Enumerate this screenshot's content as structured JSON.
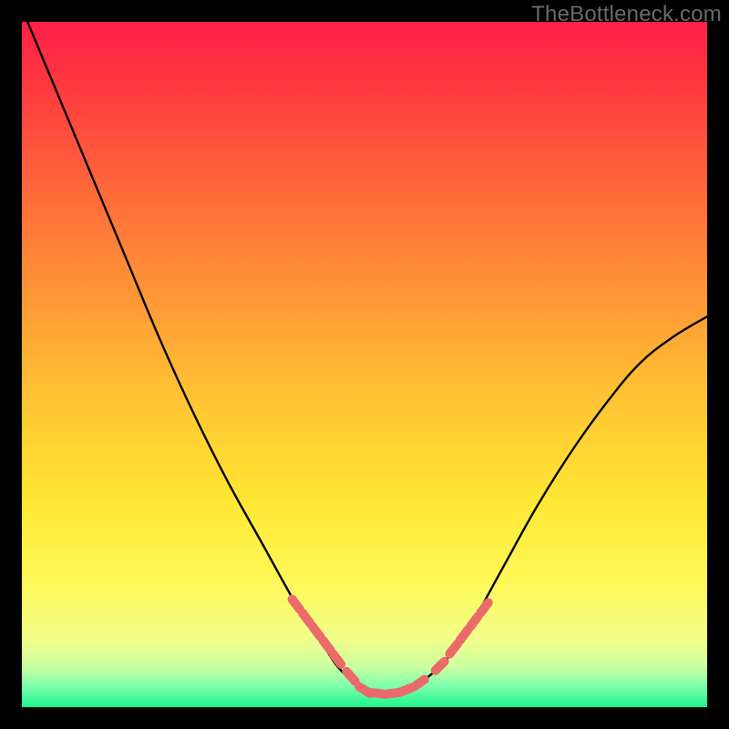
{
  "watermark": "TheBottleneck.com",
  "chart_data": {
    "type": "line",
    "title": "",
    "xlabel": "",
    "ylabel": "",
    "xlim": [
      0,
      100
    ],
    "ylim": [
      0,
      100
    ],
    "series": [
      {
        "name": "curve",
        "x": [
          0,
          5,
          10,
          15,
          20,
          25,
          30,
          35,
          40,
          42,
          44,
          46,
          48,
          50,
          52,
          54,
          56,
          58,
          60,
          62,
          65,
          70,
          75,
          80,
          85,
          90,
          95,
          100
        ],
        "values": [
          102,
          90,
          78,
          66,
          54,
          43,
          33,
          24,
          15,
          12,
          9,
          6,
          4,
          2.5,
          2,
          2,
          2.5,
          3.5,
          5,
          7,
          11,
          20,
          29,
          37,
          44,
          50,
          54,
          57
        ]
      },
      {
        "name": "markers",
        "x": [
          40,
          41.5,
          43,
          44.5,
          46,
          48,
          50,
          52,
          54,
          56,
          58,
          61,
          63,
          64.5,
          66,
          67.5
        ],
        "values": [
          15,
          13,
          11,
          9,
          7,
          4.5,
          2.5,
          2,
          2,
          2.5,
          3.5,
          6,
          8.5,
          10.5,
          12.5,
          14.5
        ]
      }
    ],
    "gradient_stops": [
      {
        "offset": 0.0,
        "color": "#ff1f47"
      },
      {
        "offset": 0.1,
        "color": "#ff3b3f"
      },
      {
        "offset": 0.25,
        "color": "#ff6a3a"
      },
      {
        "offset": 0.4,
        "color": "#ff9736"
      },
      {
        "offset": 0.55,
        "color": "#ffc433"
      },
      {
        "offset": 0.7,
        "color": "#ffe733"
      },
      {
        "offset": 0.82,
        "color": "#fff95a"
      },
      {
        "offset": 0.9,
        "color": "#f2ff8a"
      },
      {
        "offset": 0.94,
        "color": "#cdffa0"
      },
      {
        "offset": 0.97,
        "color": "#7dffac"
      },
      {
        "offset": 1.0,
        "color": "#1cf58e"
      }
    ]
  }
}
